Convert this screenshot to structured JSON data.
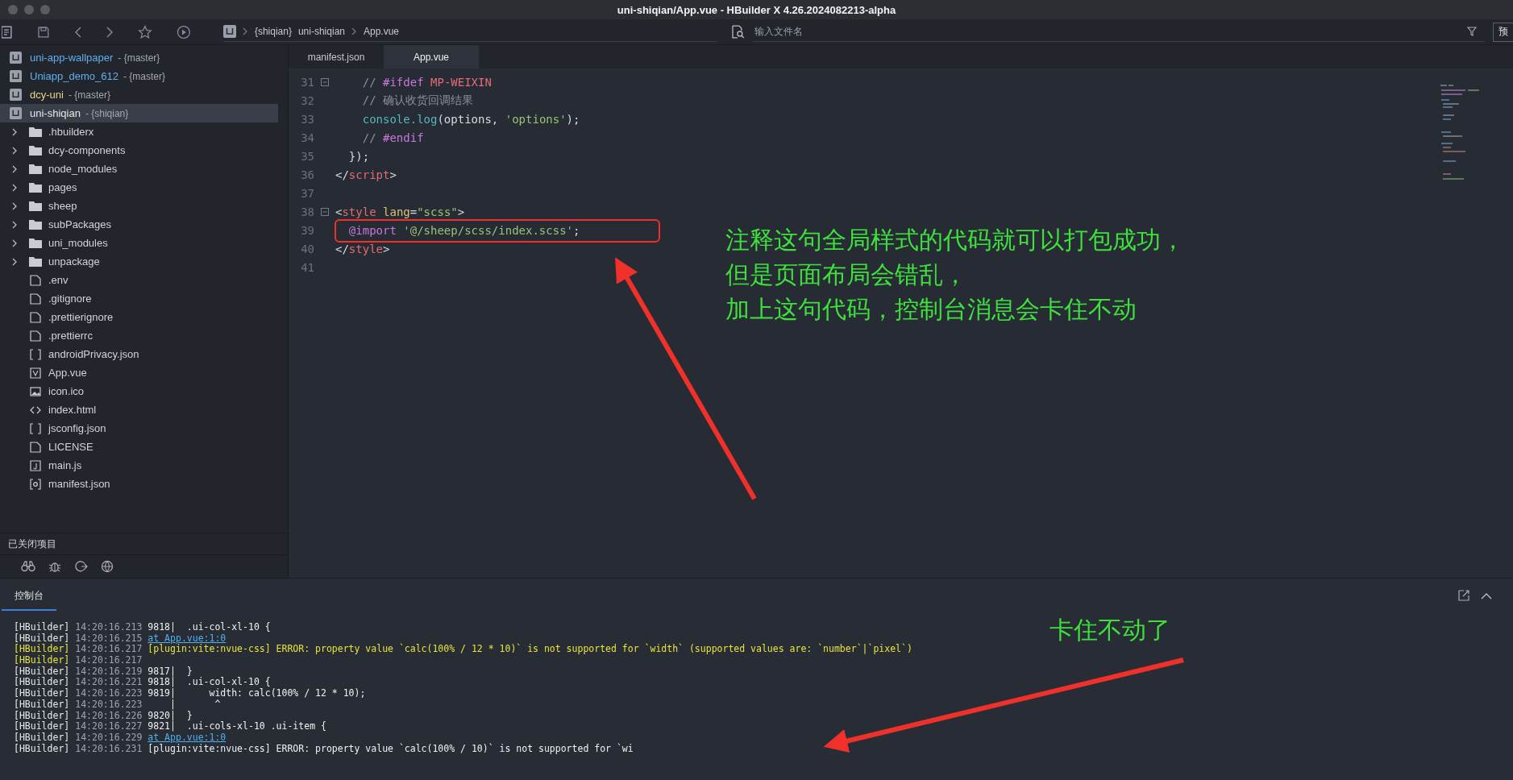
{
  "window": {
    "title": "uni-shiqian/App.vue - HBuilder X 4.26.2024082213-alpha"
  },
  "breadcrumb": [
    "{shiqian}",
    "uni-shiqian",
    "App.vue"
  ],
  "search": {
    "placeholder": "输入文件名"
  },
  "preview_button": "预",
  "sidebar": {
    "projects": [
      {
        "name": "uni-app-wallpaper",
        "branch": "- {master}",
        "color": "#5fb0f0",
        "selected": false
      },
      {
        "name": "Uniapp_demo_612",
        "branch": "- {master}",
        "color": "#5fb0f0",
        "selected": false
      },
      {
        "name": "dcy-uni",
        "branch": "- {master}",
        "color": "#e6d38a",
        "selected": false
      },
      {
        "name": "uni-shiqian",
        "branch": "- {shiqian}",
        "color": "#e8e8e8",
        "selected": true,
        "children": [
          {
            "name": ".hbuilderx",
            "kind": "folder",
            "expanded": false
          },
          {
            "name": "dcy-components",
            "kind": "folder",
            "expanded": false
          },
          {
            "name": "node_modules",
            "kind": "folder",
            "expanded": false
          },
          {
            "name": "pages",
            "kind": "folder",
            "expanded": false
          },
          {
            "name": "sheep",
            "kind": "folder",
            "expanded": false
          },
          {
            "name": "subPackages",
            "kind": "folder",
            "expanded": false
          },
          {
            "name": "uni_modules",
            "kind": "folder",
            "expanded": false
          },
          {
            "name": "unpackage",
            "kind": "folder",
            "expanded": false
          },
          {
            "name": ".env",
            "kind": "file"
          },
          {
            "name": ".gitignore",
            "kind": "file"
          },
          {
            "name": ".prettierignore",
            "kind": "file"
          },
          {
            "name": ".prettierrc",
            "kind": "file"
          },
          {
            "name": "androidPrivacy.json",
            "kind": "json"
          },
          {
            "name": "App.vue",
            "kind": "vue"
          },
          {
            "name": "icon.ico",
            "kind": "image"
          },
          {
            "name": "index.html",
            "kind": "html"
          },
          {
            "name": "jsconfig.json",
            "kind": "json"
          },
          {
            "name": "LICENSE",
            "kind": "file"
          },
          {
            "name": "main.js",
            "kind": "js"
          },
          {
            "name": "manifest.json",
            "kind": "config"
          }
        ]
      }
    ],
    "closed_projects": "已关闭项目"
  },
  "tabs": [
    {
      "label": "manifest.json",
      "selected": false
    },
    {
      "label": "App.vue",
      "selected": true
    }
  ],
  "editor": {
    "lines": [
      {
        "number": "31",
        "fold": true,
        "tokens": [
          {
            "text": "    // ",
            "kind": "comment"
          },
          {
            "text": "#ifdef",
            "kind": "keyword"
          },
          {
            "text": " MP-WEIXIN",
            "kind": "tag"
          }
        ]
      },
      {
        "number": "32",
        "fold": false,
        "tokens": [
          {
            "text": "    // 确认收货回调结果",
            "kind": "comment"
          }
        ]
      },
      {
        "number": "33",
        "fold": false,
        "tokens": [
          {
            "text": "    console.log",
            "kind": "func"
          },
          {
            "text": "(options, ",
            "kind": "plain"
          },
          {
            "text": "'options'",
            "kind": "string"
          },
          {
            "text": ");",
            "kind": "plain"
          }
        ]
      },
      {
        "number": "34",
        "fold": false,
        "tokens": [
          {
            "text": "    // ",
            "kind": "comment"
          },
          {
            "text": "#endif",
            "kind": "keyword"
          }
        ]
      },
      {
        "number": "35",
        "fold": false,
        "tokens": [
          {
            "text": "  });",
            "kind": "plain"
          }
        ]
      },
      {
        "number": "36",
        "fold": false,
        "tokens": [
          {
            "text": "</",
            "kind": "plain"
          },
          {
            "text": "script",
            "kind": "tag"
          },
          {
            "text": ">",
            "kind": "plain"
          }
        ]
      },
      {
        "number": "37",
        "fold": false
      },
      {
        "number": "38",
        "fold": true,
        "tokens": [
          {
            "text": "<",
            "kind": "plain"
          },
          {
            "text": "style",
            "kind": "tag"
          },
          {
            "text": " lang",
            "kind": "attr"
          },
          {
            "text": "=",
            "kind": "plain"
          },
          {
            "text": "\"scss\"",
            "kind": "string"
          },
          {
            "text": ">",
            "kind": "plain"
          }
        ]
      },
      {
        "number": "39",
        "fold": false,
        "tokens": [
          {
            "text": "  @import ",
            "kind": "keyword"
          },
          {
            "text": "'@/sheep/scss/index.scss'",
            "kind": "string"
          },
          {
            "text": ";",
            "kind": "plain"
          }
        ]
      },
      {
        "number": "40",
        "fold": false,
        "tokens": [
          {
            "text": "</",
            "kind": "plain"
          },
          {
            "text": "style",
            "kind": "tag"
          },
          {
            "text": ">",
            "kind": "plain"
          }
        ]
      },
      {
        "number": "41",
        "fold": false
      }
    ]
  },
  "annotations": {
    "note_lines": [
      "注释这句全局样式的代码就可以打包成功，",
      "但是页面布局会错乱，",
      "加上这句代码，控制台消息会卡住不动"
    ],
    "console_note": "卡住不动了"
  },
  "console": {
    "tab": {
      "label": "控制台",
      "selected": true
    },
    "lines": [
      {
        "prefix": "[HBuilder]",
        "time": "14:20:16.213",
        "text": "9818|  .ui-col-xl-10 {",
        "kind": "normal"
      },
      {
        "prefix": "[HBuilder]",
        "time": "14:20:16.215",
        "text": "at App.vue:1:0",
        "kind": "link"
      },
      {
        "prefix": "[HBuilder]",
        "time": "14:20:16.217",
        "text": "[plugin:vite:nvue-css] ERROR: property value `calc(100% / 12 * 10)` is not supported for `width` (supported values are: `number`|`pixel`)",
        "kind": "warning"
      },
      {
        "prefix": "[HBuilder]",
        "time": "14:20:16.217",
        "kind": "warning"
      },
      {
        "prefix": "[HBuilder]",
        "time": "14:20:16.219",
        "text": "9817|  }",
        "kind": "normal"
      },
      {
        "prefix": "[HBuilder]",
        "time": "14:20:16.221",
        "text": "9818|  .ui-col-xl-10 {",
        "kind": "normal"
      },
      {
        "prefix": "[HBuilder]",
        "time": "14:20:16.223",
        "text": "9819|      width: calc(100% / 12 * 10);",
        "kind": "normal"
      },
      {
        "prefix": "[HBuilder]",
        "time": "14:20:16.223",
        "text": "    |       ^",
        "kind": "normal"
      },
      {
        "prefix": "[HBuilder]",
        "time": "14:20:16.226",
        "text": "9820|  }",
        "kind": "normal"
      },
      {
        "prefix": "[HBuilder]",
        "time": "14:20:16.227",
        "text": "9821|  .ui-cols-xl-10 .ui-item {",
        "kind": "normal"
      },
      {
        "prefix": "[HBuilder]",
        "time": "14:20:16.229",
        "text": "at App.vue:1:0",
        "kind": "link"
      },
      {
        "prefix": "[HBuilder]",
        "time": "14:20:16.231",
        "text": "[plugin:vite:nvue-css] ERROR: property value `calc(100% / 10)` is not supported for `wi",
        "kind": "normal"
      }
    ]
  }
}
